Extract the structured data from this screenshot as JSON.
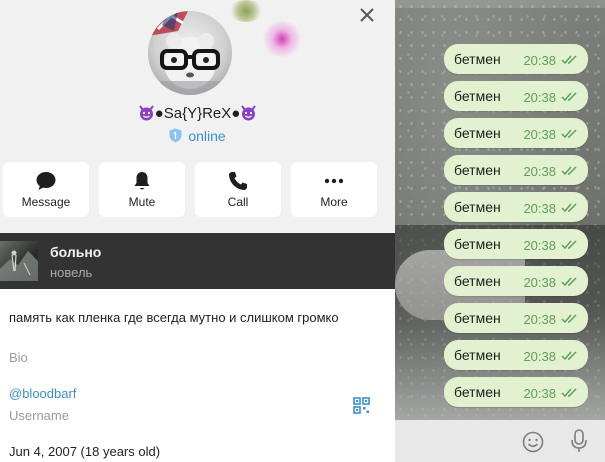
{
  "profile": {
    "name": "Sa{Y}ReX",
    "name_prefix": "●",
    "name_suffix": "●",
    "status": "online",
    "icons": {
      "close": "close-icon",
      "shield": "shield-icon",
      "devil": "devil-emoji-icon"
    }
  },
  "actions": [
    {
      "label": "Message",
      "icon": "chat-bubble-icon"
    },
    {
      "label": "Mute",
      "icon": "bell-icon"
    },
    {
      "label": "Call",
      "icon": "phone-icon"
    },
    {
      "label": "More",
      "icon": "more-dots-icon"
    }
  ],
  "music": {
    "title": "больно",
    "artist": "новель"
  },
  "info": {
    "bio": "память как пленка где всегда мутно и слишком громко",
    "bio_label": "Bio",
    "username": "@bloodbarf",
    "username_label": "Username",
    "birthday": "Jun 4, 2007 (18 years old)"
  },
  "chat": {
    "messages": [
      {
        "text": "бетмен",
        "time": "20:38"
      },
      {
        "text": "бетмен",
        "time": "20:38"
      },
      {
        "text": "бетмен",
        "time": "20:38"
      },
      {
        "text": "бетмен",
        "time": "20:38"
      },
      {
        "text": "бетмен",
        "time": "20:38"
      },
      {
        "text": "бетмен",
        "time": "20:38"
      },
      {
        "text": "бетмен",
        "time": "20:38"
      },
      {
        "text": "бетмен",
        "time": "20:38"
      },
      {
        "text": "бетмен",
        "time": "20:38"
      },
      {
        "text": "бетмен",
        "time": "20:38"
      }
    ]
  },
  "colors": {
    "accent": "#3a8fd6",
    "bubble": "#e2f1cf",
    "time": "#5ea05a",
    "music_bg": "#333333"
  }
}
